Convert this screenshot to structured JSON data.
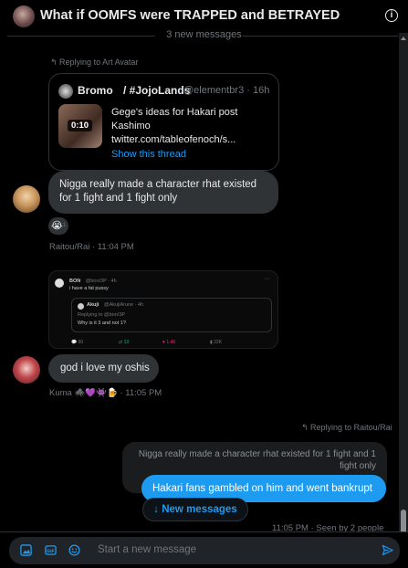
{
  "header": {
    "title": "What if OOMFS were TRAPPED and BETRAYED",
    "info_glyph": "i"
  },
  "divider": {
    "label": "3 new messages"
  },
  "message1": {
    "reply_context": "Replying to Art Avatar",
    "quote": {
      "author": "Bromo",
      "title_part": "/ #JojoLands",
      "handle": "@elementbr3 · 16h",
      "video_duration": "0:10",
      "text": "Gege's ideas for Hakari post Kashimo",
      "link": "twitter.com/tableofenoch/s...",
      "show_thread": "Show this thread"
    },
    "text": "Nigga really made a character rhat existed for 1 fight and 1 fight only",
    "reaction": {
      "emoji": "😭",
      "count": "1"
    },
    "sender": "Raitou/Rai",
    "time": "11:04 PM"
  },
  "message2": {
    "embed": {
      "author": "BON",
      "handle": "@bon/3P · 4h",
      "text": "i have a fat pussy",
      "inner_author": "Akuji",
      "inner_handle": "@AkujiArune · 4h",
      "inner_reply": "Replying to @bon/3P",
      "inner_text": "Why is it 3 and not 1?",
      "stats": [
        "60",
        "13",
        "1.4K",
        "22K"
      ]
    },
    "text": "god i love my oshis",
    "sender": "Kuma",
    "sender_emojis": "🕷️💜👾🍺",
    "time": "11:05 PM"
  },
  "message3": {
    "reply_context": "Replying to Raitou/Rai",
    "quoted": "Nigga really made a character rhat existed for 1 fight and 1 fight only",
    "text": "Hakari fans gambled on him and went bankrupt",
    "status": "11:05 PM · Seen by 2 people"
  },
  "new_messages_button": "↓ New messages",
  "composer": {
    "placeholder": "Start a new message"
  },
  "colors": {
    "accent": "#1d9bf0",
    "bubble_grey": "#2f3336",
    "background": "#000000"
  }
}
